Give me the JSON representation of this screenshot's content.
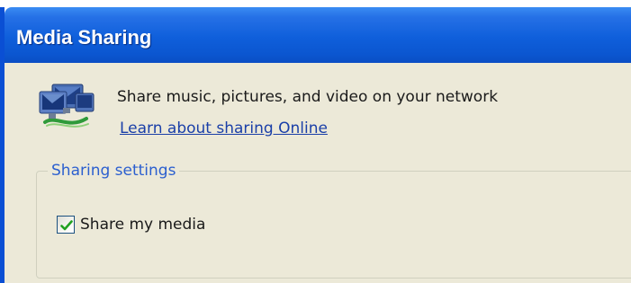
{
  "window": {
    "title": "Media Sharing"
  },
  "header": {
    "icon": "network-sharing-icon",
    "description": "Share music, pictures, and video on your network",
    "learn_link": "Learn about sharing Online"
  },
  "sharing_settings": {
    "legend": "Sharing settings",
    "share_my_media": {
      "label": "Share my media",
      "checked": true,
      "check_icon": "checkmark-icon"
    }
  },
  "colors": {
    "titlebar": "#0b56d0",
    "client_background": "#ece9d8",
    "link": "#1a3fa8",
    "group_legend": "#2b5fcf",
    "checkmark": "#21a121"
  }
}
